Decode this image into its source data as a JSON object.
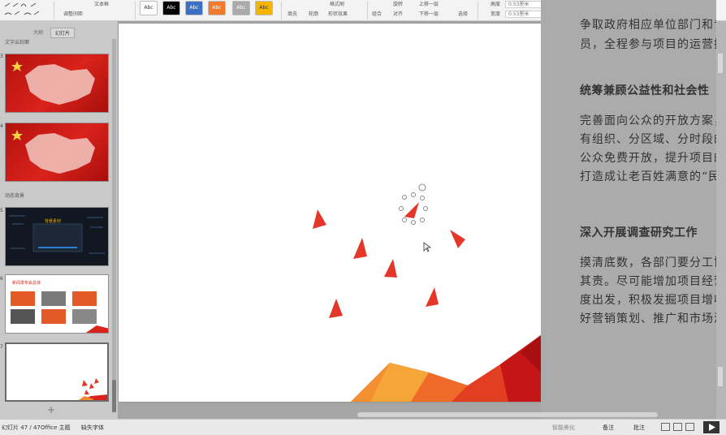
{
  "ribbon": {
    "text_box_label": "文本框",
    "line_spacing_label": "调整间距",
    "style_labels": [
      "Abc",
      "Abc",
      "Abc",
      "Abc",
      "Abc",
      "Abc"
    ],
    "style_colors": [
      "#ffffff",
      "#000000",
      "#3b6fc4",
      "#f07b2c",
      "#a9a9a9",
      "#f5b400"
    ],
    "fill_label": "填充",
    "outline_label": "轮廓",
    "format_label": "格式刷",
    "shape_effect_label": "形状效果",
    "combine_label": "组合",
    "rotate_label": "旋转",
    "align_label": "对齐",
    "bring_forward_label": "上移一层",
    "send_backward_label": "下移一层",
    "select_label": "选择",
    "height_label": "高度",
    "width_label": "宽度",
    "height_value": "0.53厘米",
    "width_value": "0.53厘米"
  },
  "left_panel": {
    "tabs": [
      "大纲",
      "幻灯片"
    ],
    "section1": "文字云封面",
    "section2": "动态背景",
    "slide_numbers": [
      "3",
      "4",
      "5",
      "6",
      "7"
    ],
    "thumb5_title": "背景素材",
    "thumb6_title": "新闻发布会总体"
  },
  "notes": {
    "lines": [
      "争取政府相应单位部门和专",
      "员，全程参与项目的运营招",
      "统筹兼顾公益性和社会性",
      "完善面向公众的开放方案，",
      "有组织、分区域、分时段的",
      "公众免费开放，提升项目的",
      "打造成让老百姓满意的“民",
      "深入开展调查研究工作",
      "摸清底数，各部门要分工协",
      "其责。尽可能增加项目经营",
      "度出发，积极发掘项目增收",
      "好营销策划、推广和市场演"
    ]
  },
  "statusbar": {
    "slide_count": "幻灯片 47 / 47",
    "theme": "Office 主题",
    "missing_font": "缺失字体",
    "smart_beautify": "智能美化",
    "notes_label": "备注",
    "comment_label": "批注"
  },
  "colors": {
    "accent_red": "#d9221b",
    "accent_orange": "#f07b2c"
  }
}
